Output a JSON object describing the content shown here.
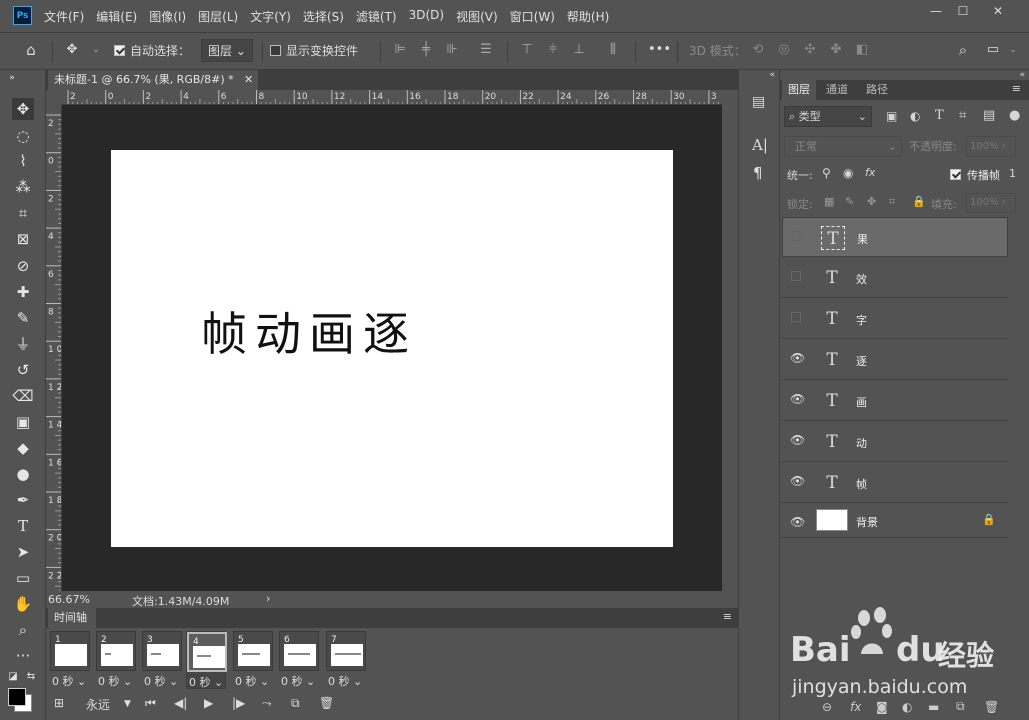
{
  "app": {
    "logo": "Ps"
  },
  "menu": [
    "文件(F)",
    "编辑(E)",
    "图像(I)",
    "图层(L)",
    "文字(Y)",
    "选择(S)",
    "滤镜(T)",
    "3D(D)",
    "视图(V)",
    "窗口(W)",
    "帮助(H)"
  ],
  "window_controls": {
    "minimize": "—",
    "maximize": "☐",
    "close": "✕"
  },
  "options": {
    "auto_select_label": "自动选择：",
    "auto_select_target": "图层",
    "show_transform_label": "显示变换控件",
    "mode_3d_label": "3D 模式："
  },
  "document": {
    "tab_title": "未标题-1 @ 66.7% (果, RGB/8#) *",
    "canvas_text": "帧动画逐",
    "zoom": "66.67%",
    "doc_info": "文档:1.43M/4.09M",
    "ruler_top": [
      "2",
      "0",
      "2",
      "4",
      "6",
      "8",
      "10",
      "12",
      "14",
      "16",
      "18",
      "20",
      "22",
      "24",
      "26",
      "28",
      "30",
      "3"
    ],
    "ruler_left": [
      "2",
      "0",
      "2",
      "4",
      "6",
      "8",
      "1\n0",
      "1\n2",
      "1\n4",
      "1\n6",
      "1\n8",
      "2\n0",
      "2\n2"
    ]
  },
  "timeline": {
    "title": "时间轴",
    "frames": [
      {
        "num": "1",
        "delay": "0 秒"
      },
      {
        "num": "2",
        "delay": "0 秒"
      },
      {
        "num": "3",
        "delay": "0 秒"
      },
      {
        "num": "4",
        "delay": "0 秒"
      },
      {
        "num": "5",
        "delay": "0 秒"
      },
      {
        "num": "6",
        "delay": "0 秒"
      },
      {
        "num": "7",
        "delay": "0 秒"
      }
    ],
    "selected_frame": 4,
    "loop": "永远"
  },
  "layers_panel": {
    "tabs": [
      "图层",
      "通道",
      "路径"
    ],
    "filter_label": "类型",
    "blend_mode": "正常",
    "opacity_label": "不透明度:",
    "opacity_value": "100%",
    "unify_label": "统一:",
    "propagate_label": "传播帧",
    "propagate_value": "1",
    "lock_label": "锁定:",
    "fill_label": "填充:",
    "fill_value": "100%",
    "layers": [
      {
        "name": "果",
        "type": "text",
        "visible": false,
        "selected": true
      },
      {
        "name": "效",
        "type": "text",
        "visible": false,
        "selected": false
      },
      {
        "name": "字",
        "type": "text",
        "visible": false,
        "selected": false
      },
      {
        "name": "逐",
        "type": "text",
        "visible": true,
        "selected": false
      },
      {
        "name": "画",
        "type": "text",
        "visible": true,
        "selected": false
      },
      {
        "name": "动",
        "type": "text",
        "visible": true,
        "selected": false
      },
      {
        "name": "帧",
        "type": "text",
        "visible": true,
        "selected": false
      },
      {
        "name": "背景",
        "type": "image",
        "visible": true,
        "selected": false
      }
    ]
  },
  "watermark": {
    "brand": "Bai",
    "brand2": "du",
    "cn": "经验",
    "url": "jingyan.baidu.com"
  },
  "colors": {
    "ui_bg": "#535353",
    "ui_dark": "#3e3e3e",
    "pasteboard": "#282828",
    "ps_blue": "#31a8ff"
  }
}
